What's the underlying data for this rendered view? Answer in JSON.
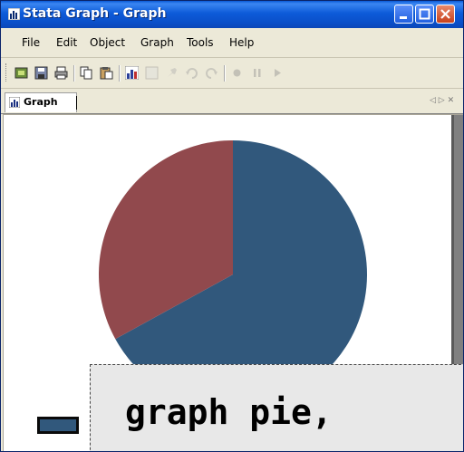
{
  "window": {
    "title": "Stata Graph - Graph"
  },
  "menu": [
    "File",
    "Edit",
    "Object",
    "Graph",
    "Tools",
    "Help"
  ],
  "toolbar": {
    "buttons": [
      "open-graph-icon",
      "save-icon",
      "print-icon",
      "copy-icon",
      "paste-icon",
      "graph-editor-icon",
      "select-icon",
      "pin-icon",
      "undo-icon",
      "redo-icon",
      "record-icon",
      "pause-icon",
      "play-icon"
    ]
  },
  "tab": {
    "label": "Graph",
    "controls": "◁ ▷ ✕"
  },
  "chart_data": {
    "type": "pie",
    "slices": [
      {
        "value": 0.67,
        "color": "#31587c"
      },
      {
        "value": 0.33,
        "color": "#91494d"
      }
    ],
    "start_angle_deg": 0
  },
  "caption": {
    "text": "graph pie,"
  },
  "colors": {
    "slice1": "#31587c",
    "slice2": "#91494d",
    "titlebar": "#0a5ad6"
  }
}
